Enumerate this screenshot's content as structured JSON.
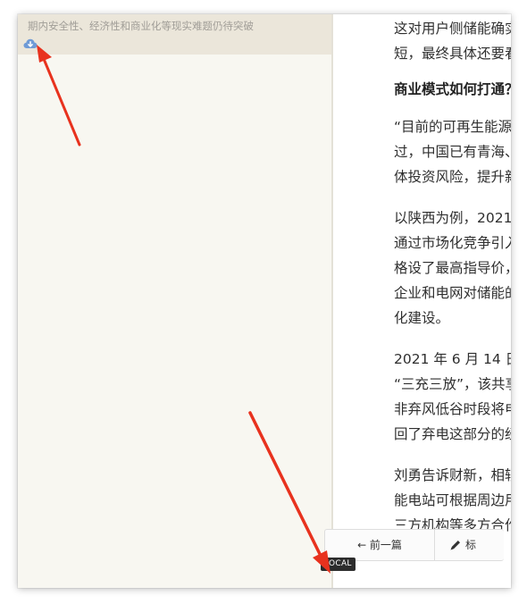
{
  "list_item": {
    "snippet": "期内安全性、经济性和商业化等现实难题仍待突破",
    "icon": "cloud-download-icon"
  },
  "article": {
    "lines": [
      {
        "text": "这对用户侧储能确实",
        "heading": false,
        "gap": 0
      },
      {
        "text": "短，最终具体还要看",
        "heading": false,
        "gap": 0
      },
      {
        "text": "商业模式如何打通？",
        "heading": true,
        "gap": 12
      },
      {
        "text": "“目前的可再生能源",
        "heading": false,
        "gap": 14
      },
      {
        "text": "过，中国已有青海、",
        "heading": false,
        "gap": 0
      },
      {
        "text": "体投资风险，提升新",
        "heading": false,
        "gap": 0
      },
      {
        "text": "以陕西为例，2021",
        "heading": false,
        "gap": 18
      },
      {
        "text": "通过市场化竞争引入",
        "heading": false,
        "gap": 0
      },
      {
        "text": "格设了最高指导价，",
        "heading": false,
        "gap": 0
      },
      {
        "text": "企业和电网对储能的",
        "heading": false,
        "gap": 0
      },
      {
        "text": "化建设。",
        "heading": false,
        "gap": 0
      },
      {
        "text": "2021 年 6 月 14 日",
        "heading": false,
        "gap": 18
      },
      {
        "text": "“三充三放”，该共享",
        "heading": false,
        "gap": 0
      },
      {
        "text": "非弃风低谷时段将电",
        "heading": false,
        "gap": 0
      },
      {
        "text": "回了弃电这部分的经",
        "heading": false,
        "gap": 0
      },
      {
        "text": "刘勇告诉财新，相较",
        "heading": false,
        "gap": 18
      },
      {
        "text": "能电站可根据周边用",
        "heading": false,
        "gap": 0
      },
      {
        "text": "三方机构等多方合作",
        "heading": false,
        "gap": 0
      }
    ]
  },
  "bottom_bar": {
    "prev_label": "← 前一篇",
    "mark_label": "标",
    "mark_icon": "pencil-icon"
  },
  "badge": {
    "label": "LOCAL"
  },
  "colors": {
    "annotation_arrow": "#e8321e",
    "left_header_bg": "#ebe6da",
    "left_pane_bg": "#f8f7f1",
    "cloud_icon": "#6f9bd6"
  }
}
